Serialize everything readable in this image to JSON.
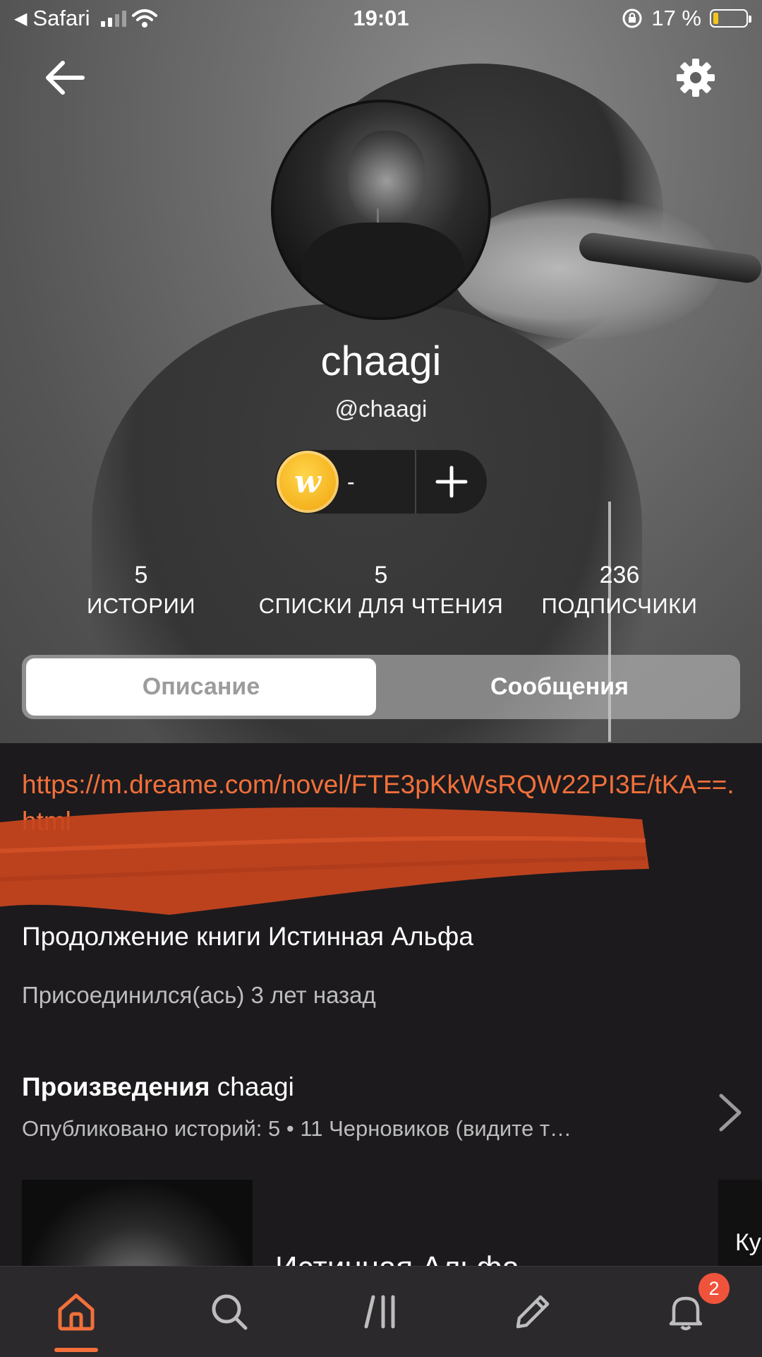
{
  "status_bar": {
    "back_app": "Safari",
    "time": "19:01",
    "battery": "17 %",
    "battery_level": 0.17,
    "signal_bars": 2
  },
  "header": {
    "back_icon": "arrow-left-icon",
    "settings_icon": "gear-icon"
  },
  "profile": {
    "display_name": "chaagi",
    "username": "@chaagi",
    "coins": "-",
    "add_icon": "plus-icon"
  },
  "stats": [
    {
      "value": "5",
      "label": "ИСТОРИИ"
    },
    {
      "value": "5",
      "label": "СПИСКИ ДЛЯ ЧТЕНИЯ"
    },
    {
      "value": "236",
      "label": "ПОДПИСЧИКИ"
    }
  ],
  "tabs": {
    "about": "Описание",
    "messages": "Сообщения",
    "active": "about"
  },
  "about": {
    "link": "https://m.dreame.com/novel/FTE3pKkWsRQW22PI3E/tKA==.html",
    "description": "Продолжение книги Истинная Альфа",
    "joined": "Присоединился(ась) 3 лет назад"
  },
  "works": {
    "title_bold": "Произведения",
    "title_user": "chaagi",
    "subtitle": "Опубликовано историй: 5 • 11 Черновиков (видите т…",
    "book_title": "Истинная Альфа",
    "next_book_peek": "Ку"
  },
  "bottom_nav": {
    "items": [
      "home-icon",
      "search-icon",
      "library-icon",
      "write-icon",
      "bell-icon"
    ],
    "active": "home",
    "notifications_badge": "2"
  },
  "colors": {
    "accent": "#f2703a",
    "badge": "#f0533c",
    "background": "#1c1a1d",
    "tabbar": "#2b292c"
  }
}
